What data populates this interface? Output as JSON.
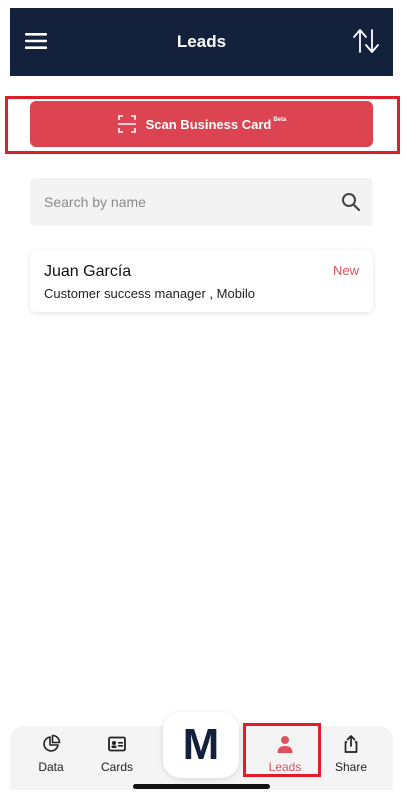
{
  "header": {
    "title": "Leads",
    "background": "#14213d"
  },
  "scan": {
    "label": "Scan Business Card",
    "badge": "Beta",
    "color": "#dc4452"
  },
  "search": {
    "placeholder": "Search by name"
  },
  "leads": [
    {
      "name": "Juan García",
      "subtitle": "Customer success manager , Mobilo",
      "badge": "New"
    }
  ],
  "bottom_nav": {
    "items": [
      {
        "label": "Data",
        "icon": "pie-chart-icon"
      },
      {
        "label": "Cards",
        "icon": "id-card-icon"
      },
      {
        "label": "Leads",
        "icon": "person-icon",
        "active": true
      },
      {
        "label": "Share",
        "icon": "share-icon"
      }
    ],
    "logo": "M",
    "active_color": "#e0505e"
  }
}
